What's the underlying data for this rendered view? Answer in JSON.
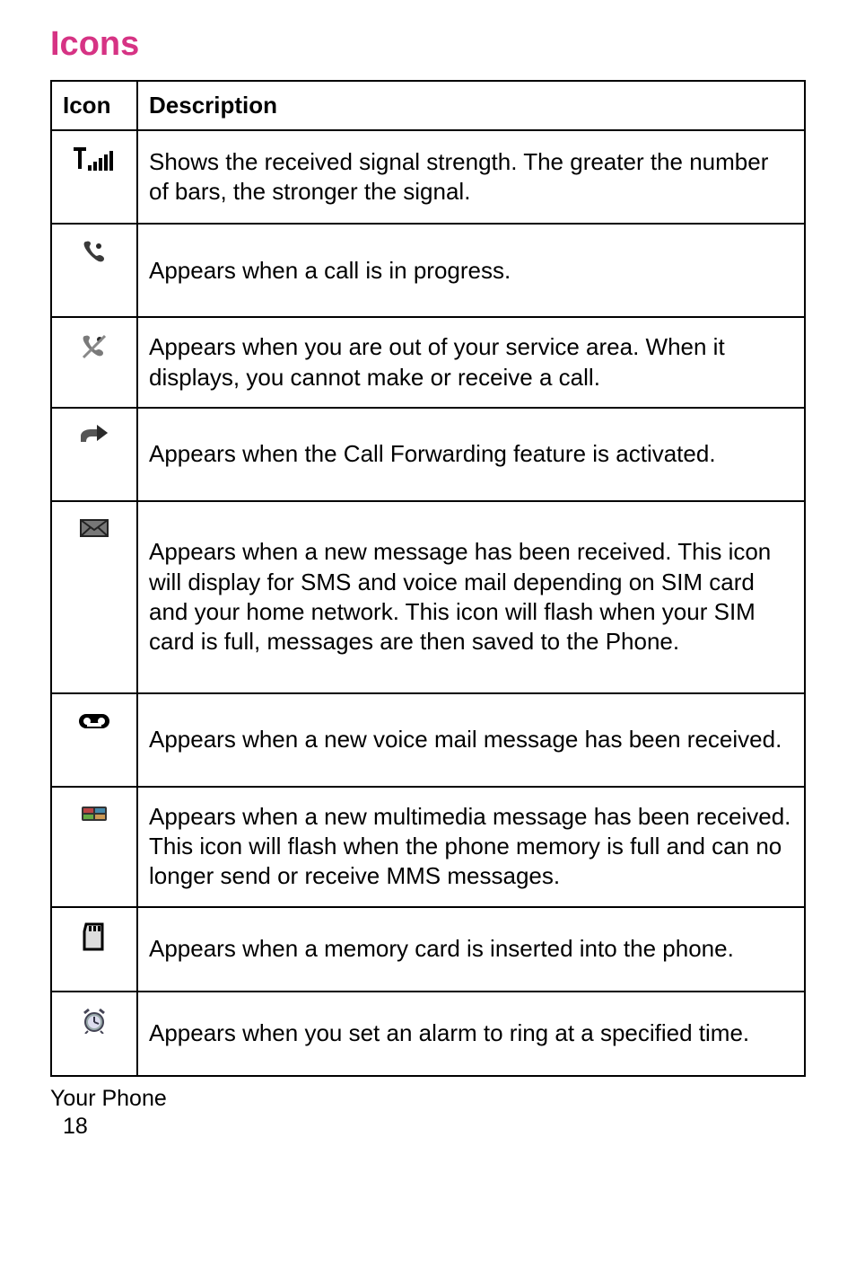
{
  "heading": "Icons",
  "table": {
    "header_icon": "Icon",
    "header_desc": "Description",
    "rows": [
      {
        "icon_name": "signal-strength-icon",
        "desc": "Shows the received signal strength. The greater the number of bars, the stronger the signal."
      },
      {
        "icon_name": "call-in-progress-icon",
        "desc": "Appears when a call is in progress."
      },
      {
        "icon_name": "no-service-icon",
        "desc": "Appears when you are out of your service area. When it displays, you cannot make or receive a call."
      },
      {
        "icon_name": "call-forwarding-icon",
        "desc": "Appears when the Call Forwarding feature is activated."
      },
      {
        "icon_name": "new-message-icon",
        "desc": "Appears when a new message has been received. This icon will display for SMS and voice mail depending on SIM card and your home network. This icon will flash when your SIM card is full, messages are then saved to the Phone."
      },
      {
        "icon_name": "voice-mail-icon",
        "desc": "Appears when a new voice mail message has been received."
      },
      {
        "icon_name": "multimedia-message-icon",
        "desc": "Appears when a new multimedia message has been received. This icon will flash when the phone memory is full and can no longer send or receive MMS messages."
      },
      {
        "icon_name": "memory-card-icon",
        "desc": "Appears when a memory card is inserted into the phone."
      },
      {
        "icon_name": "alarm-icon",
        "desc": "Appears when you set an alarm to ring at a specified time."
      }
    ]
  },
  "footer": {
    "section": "Your Phone",
    "page_number": "18"
  }
}
